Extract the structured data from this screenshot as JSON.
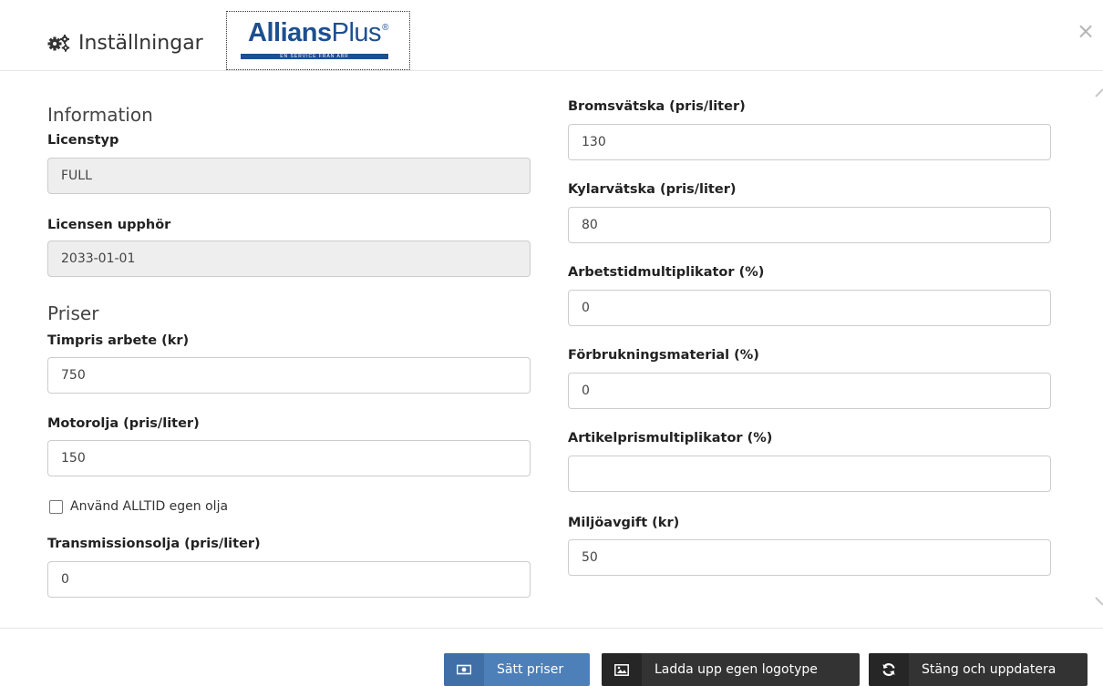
{
  "header": {
    "settings_tab": "Inställningar",
    "logo": {
      "bold": "Allians",
      "light": "Plus",
      "registered": "®",
      "tagline": "EN SERVICE FRÅN ABR"
    },
    "close": "×"
  },
  "left": {
    "information_title": "Information",
    "license_type_label": "Licenstyp",
    "license_type_value": "FULL",
    "license_expires_label": "Licensen upphör",
    "license_expires_value": "2033-01-01",
    "prices_title": "Priser",
    "hourly_label": "Timpris arbete (kr)",
    "hourly_value": "750",
    "motor_oil_label": "Motorolja (pris/liter)",
    "motor_oil_value": "150",
    "own_oil_checkbox": "Använd ALLTID egen olja",
    "transmission_label": "Transmissionsolja (pris/liter)",
    "transmission_value": "0"
  },
  "right": {
    "brake_fluid_label": "Bromsvätska (pris/liter)",
    "brake_fluid_value": "130",
    "coolant_label": "Kylarvätska (pris/liter)",
    "coolant_value": "80",
    "work_multiplier_label": "Arbetstidmultiplikator (%)",
    "work_multiplier_value": "0",
    "consumables_label": "Förbrukningsmaterial (%)",
    "consumables_value": "0",
    "article_multiplier_label": "Artikelprismultiplikator (%)",
    "article_multiplier_value": "",
    "env_fee_label": "Miljöavgift (kr)",
    "env_fee_value": "50"
  },
  "footer": {
    "set_prices": "Sätt priser",
    "upload_logo": "Ladda upp egen logotype",
    "close_update": "Stäng och uppdatera"
  },
  "colors": {
    "primary": "#4d7fb8",
    "dark": "#333333",
    "logo_blue": "#1d4f91"
  }
}
